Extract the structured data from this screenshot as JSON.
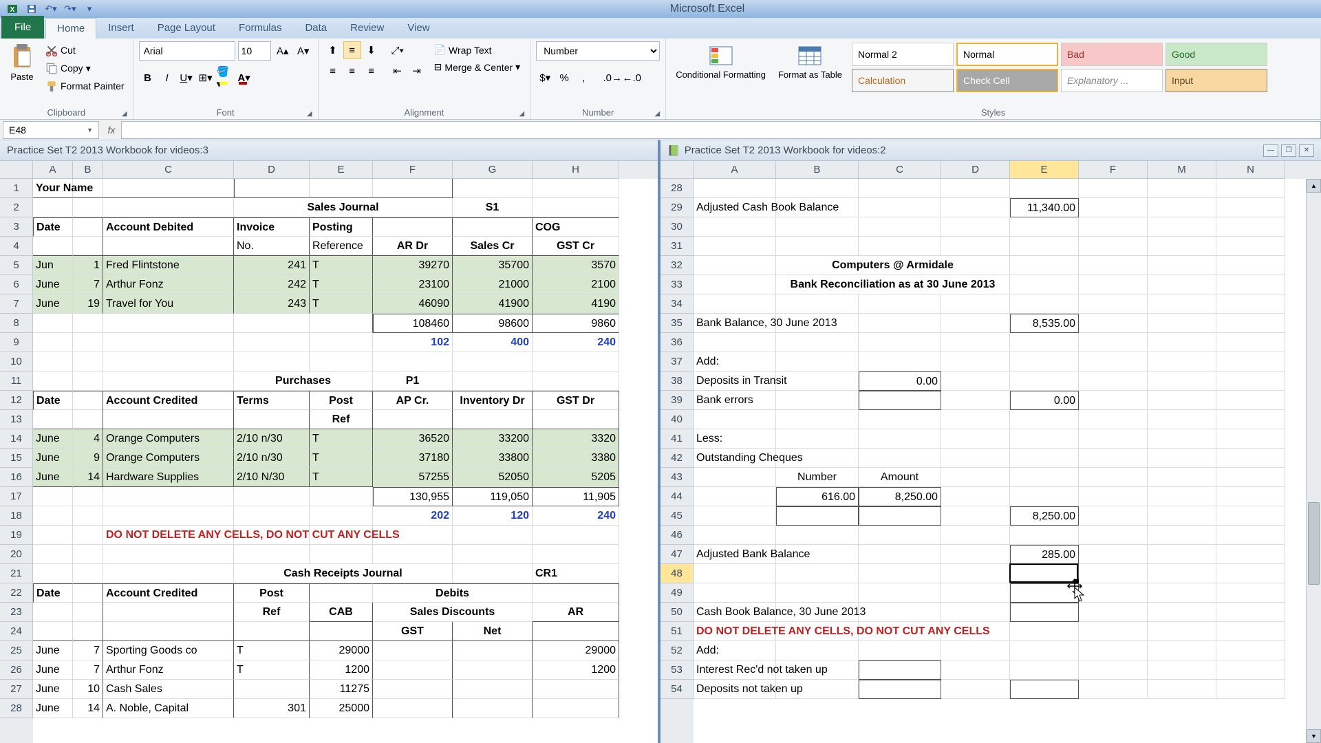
{
  "app_title": "Microsoft Excel",
  "ribbon": {
    "tabs": [
      "File",
      "Home",
      "Insert",
      "Page Layout",
      "Formulas",
      "Data",
      "Review",
      "View"
    ],
    "active_tab": "Home",
    "clipboard": {
      "paste": "Paste",
      "cut": "Cut",
      "copy": "Copy",
      "format_painter": "Format Painter",
      "label": "Clipboard"
    },
    "font": {
      "name": "Arial",
      "size": "10",
      "label": "Font"
    },
    "alignment": {
      "wrap": "Wrap Text",
      "merge": "Merge & Center",
      "label": "Alignment"
    },
    "number": {
      "format": "Number",
      "label": "Number"
    },
    "styles": {
      "cond": "Conditional Formatting",
      "as_table": "Format as Table",
      "label": "Styles",
      "gallery": [
        "Normal 2",
        "Normal",
        "Bad",
        "Good",
        "Calculation",
        "Check Cell",
        "Explanatory ...",
        "Input"
      ]
    }
  },
  "name_box": "E48",
  "formula": "",
  "panes": {
    "left_title": "Practice Set T2 2013 Workbook for videos:3",
    "right_title": "Practice Set T2 2013 Workbook for videos:2"
  },
  "left": {
    "cols": [
      "A",
      "B",
      "C",
      "D",
      "E",
      "F",
      "G",
      "H"
    ],
    "widths": [
      58,
      44,
      190,
      110,
      92,
      116,
      116,
      126
    ],
    "row_start": 1,
    "rows": [
      {
        "n": 1,
        "cells": {
          "A": "Your Name"
        },
        "bold": [
          "A"
        ],
        "b_b": [
          "A",
          "B",
          "C",
          "D",
          "E",
          "F"
        ],
        "b_r": [
          "F"
        ],
        "b_l": [
          "D"
        ]
      },
      {
        "n": 2,
        "cells": {
          "D": "Sales Journal",
          "G": "S1"
        },
        "bold": [
          "D",
          "G"
        ],
        "center": [
          "D",
          "G"
        ],
        "span": {
          "D": 3
        }
      },
      {
        "n": 3,
        "cells": {
          "A": "Date",
          "C": "Account Debited",
          "D": "Invoice",
          "E": "Posting",
          "H": "COG"
        },
        "bold": [
          "A",
          "C",
          "D",
          "E",
          "H"
        ],
        "b_t": [
          "A",
          "B",
          "C",
          "D",
          "E",
          "F",
          "G",
          "H"
        ],
        "b_r": [
          "B",
          "C",
          "D",
          "E",
          "F",
          "G"
        ],
        "b_l": [
          "A"
        ]
      },
      {
        "n": 4,
        "cells": {
          "D": "No.",
          "E": "Reference",
          "F": "AR Dr",
          "G": "Sales Cr",
          "H": "GST Cr"
        },
        "bold": [
          "F",
          "G",
          "H"
        ],
        "center": [
          "F",
          "G",
          "H"
        ],
        "b_b": [
          "A",
          "B",
          "C",
          "D",
          "E",
          "F",
          "G",
          "H"
        ],
        "b_r": [
          "B",
          "C",
          "D",
          "E",
          "F",
          "G"
        ]
      },
      {
        "n": 5,
        "cells": {
          "A": "Jun",
          "B": "1",
          "C": "Fred Flintstone",
          "D": "241",
          "E": "T",
          "F": "39270",
          "G": "35700",
          "H": "3570"
        },
        "right": [
          "B",
          "D",
          "F",
          "G",
          "H"
        ],
        "green": [
          "A",
          "B",
          "C",
          "D",
          "E",
          "F",
          "G",
          "H"
        ],
        "b_r": [
          "B",
          "C",
          "D",
          "E",
          "F",
          "G"
        ]
      },
      {
        "n": 6,
        "cells": {
          "A": "June",
          "B": "7",
          "C": "Arthur Fonz",
          "D": "242",
          "E": "T",
          "F": "23100",
          "G": "21000",
          "H": "2100"
        },
        "right": [
          "B",
          "D",
          "F",
          "G",
          "H"
        ],
        "green": [
          "A",
          "B",
          "C",
          "D",
          "E",
          "F",
          "G",
          "H"
        ],
        "b_r": [
          "B",
          "C",
          "D",
          "E",
          "F",
          "G"
        ]
      },
      {
        "n": 7,
        "cells": {
          "A": "June",
          "B": "19",
          "C": "Travel for You",
          "D": "243",
          "E": "T",
          "F": "46090",
          "G": "41900",
          "H": "4190"
        },
        "right": [
          "B",
          "D",
          "F",
          "G",
          "H"
        ],
        "green": [
          "A",
          "B",
          "C",
          "D",
          "E",
          "F",
          "G",
          "H"
        ],
        "b_r": [
          "B",
          "C",
          "D",
          "E",
          "F",
          "G"
        ]
      },
      {
        "n": 8,
        "cells": {
          "F": "108460",
          "G": "98600",
          "H": "9860"
        },
        "right": [
          "F",
          "G",
          "H"
        ],
        "b_t": [
          "F",
          "G",
          "H"
        ],
        "b_b": [
          "F",
          "G",
          "H"
        ],
        "b_r": [
          "E",
          "F",
          "G"
        ],
        "b_l": [
          "F"
        ]
      },
      {
        "n": 9,
        "cells": {
          "F": "102",
          "G": "400",
          "H": "240"
        },
        "right": [
          "F",
          "G",
          "H"
        ],
        "blue": [
          "F",
          "G",
          "H"
        ],
        "bold": [
          "F",
          "G",
          "H"
        ],
        "center": [
          "F",
          "G",
          "H"
        ]
      },
      {
        "n": 11,
        "cells": {
          "D": "Purchases",
          "F": "P1"
        },
        "bold": [
          "D",
          "F"
        ],
        "center": [
          "D",
          "F"
        ],
        "span": {
          "D": 2
        }
      },
      {
        "n": 12,
        "cells": {
          "A": "Date",
          "C": "Account Credited",
          "D": "Terms",
          "E": "Post",
          "F": "AP Cr.",
          "G": "Inventory Dr",
          "H": "GST Dr"
        },
        "bold": [
          "A",
          "C",
          "D",
          "E",
          "F",
          "G",
          "H"
        ],
        "center": [
          "E",
          "F",
          "G",
          "H"
        ],
        "b_t": [
          "A",
          "B",
          "C",
          "D",
          "E",
          "F",
          "G",
          "H"
        ],
        "b_r": [
          "B",
          "C",
          "D",
          "E",
          "F",
          "G",
          "H"
        ],
        "b_l": [
          "A"
        ]
      },
      {
        "n": 13,
        "cells": {
          "E": "Ref"
        },
        "bold": [
          "E"
        ],
        "center": [
          "E"
        ],
        "b_b": [
          "A",
          "B",
          "C",
          "D",
          "E",
          "F",
          "G",
          "H"
        ],
        "b_r": [
          "B",
          "C",
          "D",
          "E",
          "F",
          "G",
          "H"
        ]
      },
      {
        "n": 14,
        "cells": {
          "A": "June",
          "B": "4",
          "C": "Orange Computers",
          "D": "2/10 n/30",
          "E": "T",
          "F": "36520",
          "G": "33200",
          "H": "3320"
        },
        "right": [
          "B",
          "F",
          "G",
          "H"
        ],
        "green": [
          "A",
          "B",
          "C",
          "D",
          "E",
          "F",
          "G",
          "H"
        ],
        "b_r": [
          "B",
          "C",
          "D",
          "E",
          "F",
          "G",
          "H"
        ]
      },
      {
        "n": 15,
        "cells": {
          "A": "June",
          "B": "9",
          "C": "Orange Computers",
          "D": "2/10 n/30",
          "E": "T",
          "F": "37180",
          "G": "33800",
          "H": "3380"
        },
        "right": [
          "B",
          "F",
          "G",
          "H"
        ],
        "green": [
          "A",
          "B",
          "C",
          "D",
          "E",
          "F",
          "G",
          "H"
        ],
        "b_r": [
          "B",
          "C",
          "D",
          "E",
          "F",
          "G",
          "H"
        ]
      },
      {
        "n": 16,
        "cells": {
          "A": "June",
          "B": "14",
          "C": "Hardware Supplies",
          "D": "2/10 N/30",
          "E": "T",
          "F": "57255",
          "G": "52050",
          "H": "5205"
        },
        "right": [
          "B",
          "F",
          "G",
          "H"
        ],
        "green": [
          "A",
          "B",
          "C",
          "D",
          "E",
          "F",
          "G",
          "H"
        ],
        "b_r": [
          "B",
          "C",
          "D",
          "E",
          "F",
          "G",
          "H"
        ],
        "b_b": [
          "A",
          "B",
          "C",
          "D",
          "E"
        ]
      },
      {
        "n": 17,
        "cells": {
          "F": "130,955",
          "G": "119,050",
          "H": "11,905"
        },
        "right": [
          "F",
          "G",
          "H"
        ],
        "b_t": [
          "F",
          "G",
          "H"
        ],
        "b_b": [
          "F",
          "G",
          "H"
        ],
        "b_r": [
          "F",
          "G",
          "H"
        ],
        "b_l": [
          "F"
        ]
      },
      {
        "n": 18,
        "cells": {
          "F": "202",
          "G": "120",
          "H": "240"
        },
        "right": [
          "F",
          "G",
          "H"
        ],
        "blue": [
          "F",
          "G",
          "H"
        ],
        "bold": [
          "F",
          "G",
          "H"
        ]
      },
      {
        "n": 19,
        "cells": {
          "C": "DO NOT DELETE ANY CELLS, DO NOT CUT ANY CELLS"
        },
        "red": [
          "C"
        ],
        "bold": [
          "C"
        ],
        "ovf": [
          "C"
        ]
      },
      {
        "n": 21,
        "cells": {
          "D": "Cash Receipts Journal",
          "H": "CR1"
        },
        "bold": [
          "D",
          "H"
        ],
        "center": [
          "D"
        ],
        "span": {
          "D": 3
        }
      },
      {
        "n": 22,
        "cells": {
          "A": "Date",
          "C": "Account Credited",
          "D": "Post",
          "F": "Debits"
        },
        "bold": [
          "A",
          "C",
          "D",
          "F"
        ],
        "center": [
          "D",
          "F"
        ],
        "span": {
          "F": 2
        },
        "b_t": [
          "A",
          "B",
          "C",
          "D",
          "E",
          "F",
          "G",
          "H"
        ],
        "b_r": [
          "B",
          "C",
          "D",
          "G",
          "H"
        ],
        "b_l": [
          "A"
        ]
      },
      {
        "n": 23,
        "cells": {
          "D": "Ref",
          "E": "CAB",
          "F": "Sales Discounts",
          "H": "AR"
        },
        "bold": [
          "D",
          "E",
          "F",
          "H"
        ],
        "center": [
          "D",
          "E",
          "F",
          "H"
        ],
        "span": {
          "F": 2
        },
        "b_r": [
          "B",
          "C",
          "D",
          "E",
          "G",
          "H"
        ],
        "b_b": [
          "E",
          "H"
        ]
      },
      {
        "n": 24,
        "cells": {
          "F": "GST",
          "G": "Net"
        },
        "bold": [
          "F",
          "G"
        ],
        "center": [
          "F",
          "G"
        ],
        "b_b": [
          "A",
          "B",
          "C",
          "D",
          "E",
          "F",
          "G",
          "H"
        ],
        "b_r": [
          "B",
          "C",
          "D",
          "E",
          "F",
          "G",
          "H"
        ]
      },
      {
        "n": 25,
        "cells": {
          "A": "June",
          "B": "7",
          "C": "Sporting Goods co",
          "D": "T",
          "E": "29000",
          "H": "29000"
        },
        "right": [
          "B",
          "E",
          "H"
        ],
        "b_r": [
          "B",
          "C",
          "D",
          "E",
          "F",
          "G",
          "H"
        ]
      },
      {
        "n": 26,
        "cells": {
          "A": "June",
          "B": "7",
          "C": "Arthur Fonz",
          "D": "T",
          "E": "1200",
          "H": "1200"
        },
        "right": [
          "B",
          "E",
          "H"
        ],
        "b_r": [
          "B",
          "C",
          "D",
          "E",
          "F",
          "G",
          "H"
        ]
      },
      {
        "n": 27,
        "cells": {
          "A": "June",
          "B": "10",
          "C": "Cash Sales",
          "E": "11275"
        },
        "right": [
          "B",
          "E"
        ],
        "b_r": [
          "B",
          "C",
          "D",
          "E",
          "F",
          "G",
          "H"
        ]
      },
      {
        "n": 28,
        "cells": {
          "A": "June",
          "B": "14",
          "C": "A. Noble, Capital",
          "D": "301",
          "E": "25000"
        },
        "right": [
          "B",
          "D",
          "E"
        ],
        "b_r": [
          "B",
          "C",
          "D",
          "E",
          "F",
          "G",
          "H"
        ]
      }
    ],
    "warning": "DO NOT DELETE ANY CELLS, DO NOT CUT ANY CELLS"
  },
  "right": {
    "cols": [
      "A",
      "B",
      "C",
      "D",
      "E",
      "F",
      "M",
      "N"
    ],
    "widths": [
      120,
      120,
      120,
      100,
      100,
      100,
      100,
      100
    ],
    "row_start": 28,
    "rows": [
      {
        "n": 28
      },
      {
        "n": 29,
        "cells": {
          "A": "Adjusted Cash Book Balance",
          "E": "11,340.00"
        },
        "right": [
          "E"
        ],
        "ovf": [
          "A"
        ],
        "b_all": [
          "E"
        ]
      },
      {
        "n": 30
      },
      {
        "n": 31
      },
      {
        "n": 32,
        "cells": {
          "B": "Computers @ Armidale"
        },
        "bold": [
          "B"
        ],
        "center": [
          "B"
        ],
        "ovf": [
          "B"
        ],
        "span": {
          "B": 3
        }
      },
      {
        "n": 33,
        "cells": {
          "B": "Bank Reconciliation as at 30 June 2013"
        },
        "bold": [
          "B"
        ],
        "center": [
          "B"
        ],
        "ovf": [
          "B"
        ],
        "span": {
          "B": 3
        }
      },
      {
        "n": 34
      },
      {
        "n": 35,
        "cells": {
          "A": "Bank Balance, 30 June 2013",
          "E": "8,535.00"
        },
        "right": [
          "E"
        ],
        "ovf": [
          "A"
        ],
        "b_all": [
          "E"
        ]
      },
      {
        "n": 36
      },
      {
        "n": 37,
        "cells": {
          "A": "Add:"
        }
      },
      {
        "n": 38,
        "cells": {
          "A": "Deposits in Transit",
          "C": "0.00"
        },
        "right": [
          "C"
        ],
        "b_all": [
          "C"
        ]
      },
      {
        "n": 39,
        "cells": {
          "A": "Bank errors",
          "E": "0.00"
        },
        "right": [
          "E"
        ],
        "b_all": [
          "C",
          "E"
        ]
      },
      {
        "n": 40
      },
      {
        "n": 41,
        "cells": {
          "A": "Less:"
        }
      },
      {
        "n": 42,
        "cells": {
          "A": "Outstanding Cheques"
        },
        "ovf": [
          "A"
        ]
      },
      {
        "n": 43,
        "cells": {
          "B": "Number",
          "C": "Amount"
        },
        "center": [
          "B",
          "C"
        ]
      },
      {
        "n": 44,
        "cells": {
          "B": "616.00",
          "C": "8,250.00"
        },
        "right": [
          "B",
          "C"
        ],
        "b_all": [
          "B",
          "C"
        ]
      },
      {
        "n": 45,
        "cells": {
          "E": "8,250.00"
        },
        "right": [
          "E"
        ],
        "b_all": [
          "B",
          "C",
          "E"
        ]
      },
      {
        "n": 46
      },
      {
        "n": 47,
        "cells": {
          "A": "Adjusted Bank Balance",
          "E": "285.00"
        },
        "right": [
          "E"
        ],
        "ovf": [
          "A"
        ],
        "b_all": [
          "E"
        ]
      },
      {
        "n": 48,
        "sel": true,
        "b_all": [
          "E"
        ]
      },
      {
        "n": 49,
        "b_all": [
          "E"
        ]
      },
      {
        "n": 50,
        "cells": {
          "A": "Cash Book Balance, 30 June 2013"
        },
        "ovf": [
          "A"
        ],
        "b_all": [
          "E"
        ]
      },
      {
        "n": 51,
        "cells": {
          "A": "DO NOT DELETE ANY CELLS, DO NOT CUT ANY CELLS"
        },
        "red": [
          "A"
        ],
        "bold": [
          "A"
        ],
        "ovf": [
          "A"
        ]
      },
      {
        "n": 52,
        "cells": {
          "A": "Add:"
        }
      },
      {
        "n": 53,
        "cells": {
          "A": "Interest Rec'd not taken up"
        },
        "ovf": [
          "A"
        ],
        "b_all": [
          "C"
        ]
      },
      {
        "n": 54,
        "cells": {
          "A": "Deposits not taken up"
        },
        "ovf": [
          "A"
        ],
        "b_all": [
          "C",
          "E"
        ]
      }
    ]
  },
  "selection": {
    "pane": "right",
    "cell": "E48"
  }
}
